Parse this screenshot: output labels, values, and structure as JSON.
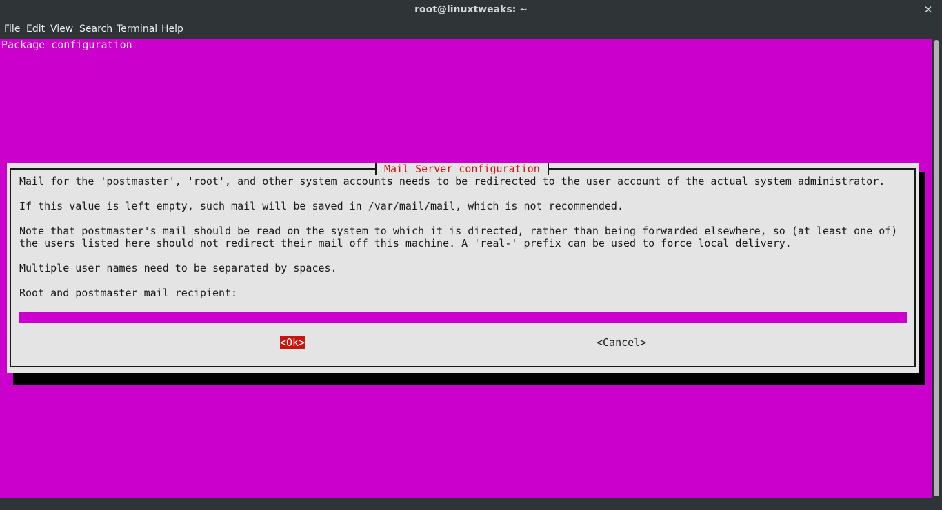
{
  "window": {
    "title": "root@linuxtweaks: ~",
    "close_glyph": "✕"
  },
  "menu": {
    "items": [
      {
        "label": "File"
      },
      {
        "label": "Edit"
      },
      {
        "label": "View"
      },
      {
        "label": "Search"
      },
      {
        "label": "Terminal"
      },
      {
        "label": "Help"
      }
    ]
  },
  "terminal": {
    "header": "Package configuration",
    "background_color": "#cc00cc"
  },
  "dialog": {
    "title": "Mail Server configuration",
    "paragraphs": [
      "Mail for the 'postmaster', 'root', and other system accounts needs to be redirected to the user account of the actual system administrator.",
      "If this value is left empty, such mail will be saved in /var/mail/mail, which is not recommended.",
      "Note that postmaster's mail should be read on the system to which it is directed, rather than being forwarded elsewhere, so (at least one of)",
      "the users listed here should not redirect their mail off this machine. A 'real-' prefix can be used to force local delivery.",
      "Multiple user names need to be separated by spaces.",
      "Root and postmaster mail recipient:"
    ],
    "input_value": "",
    "ok_label": "<Ok>",
    "cancel_label": "<Cancel>",
    "title_color": "#c8160e",
    "ok_background": "#c8160e"
  }
}
